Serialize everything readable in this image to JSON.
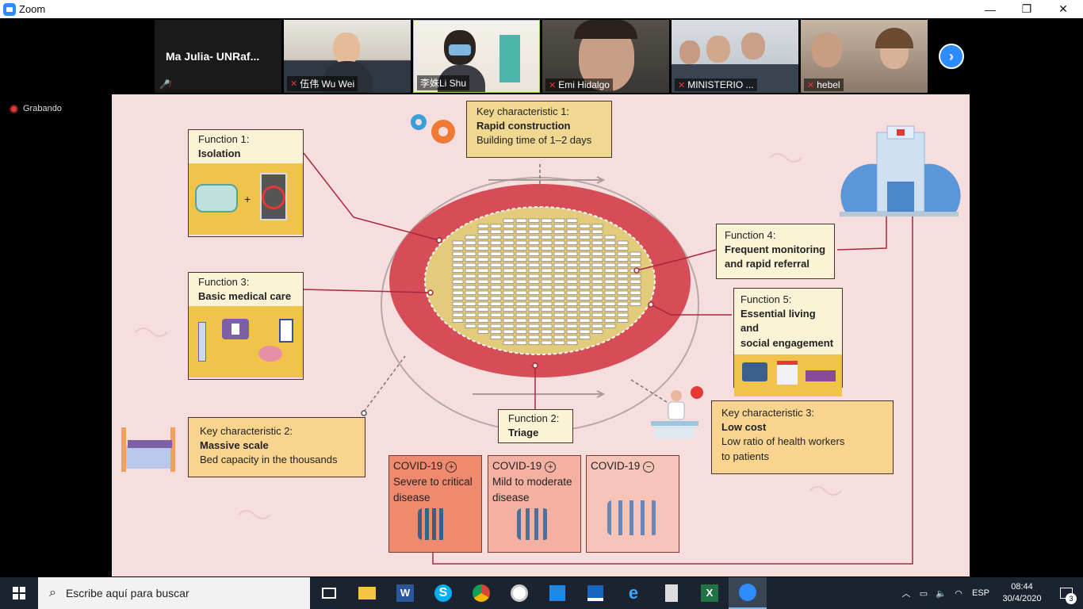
{
  "window": {
    "title": "Zoom",
    "minimize": "—",
    "maximize": "❐",
    "close": "✕"
  },
  "participants": [
    {
      "name": "Ma Julia- UNRaf...",
      "kind": "text"
    },
    {
      "name": "伍伟  Wu Wei",
      "kind": "video"
    },
    {
      "name": "李姝Li Shu",
      "kind": "video"
    },
    {
      "name": "Emi Hidalgo",
      "kind": "video"
    },
    {
      "name": "MINISTERIO ...",
      "kind": "video"
    },
    {
      "name": "hebel",
      "kind": "video"
    }
  ],
  "recording": {
    "label": "Grabando"
  },
  "slide": {
    "kc1": {
      "title": "Key characteristic 1:",
      "bold": "Rapid construction",
      "detail": "Building time of 1–2 days"
    },
    "kc2": {
      "title": "Key characteristic 2:",
      "bold": "Massive scale",
      "detail": "Bed capacity in the thousands"
    },
    "kc3": {
      "title": "Key characteristic 3:",
      "bold": "Low cost",
      "detail1": "Low ratio of health workers",
      "detail2": "to patients"
    },
    "f1": {
      "title": "Function 1:",
      "bold": "Isolation"
    },
    "f2": {
      "title": "Function 2:",
      "bold": "Triage"
    },
    "f3": {
      "title": "Function 3:",
      "bold": "Basic medical care"
    },
    "f4": {
      "title": "Function 4:",
      "bold1": "Frequent monitoring",
      "bold2": "and rapid referral"
    },
    "f5": {
      "title": "Function 5:",
      "bold1": "Essential living and",
      "bold2": "social engagement"
    },
    "covid": [
      {
        "label": "COVID-19",
        "sign": "+",
        "line1": "Severe to critical",
        "line2": " disease",
        "color": "#f08a6e"
      },
      {
        "label": "COVID-19",
        "sign": "+",
        "line1": "Mild to moderate",
        "line2": "disease",
        "color": "#f4b0a0"
      },
      {
        "label": "COVID-19",
        "sign": "−",
        "line1": "",
        "line2": "",
        "color": "#f6c4b8"
      }
    ],
    "colors": {
      "track": "#d64d58",
      "field": "#e2cc7c",
      "line": "#a8283c",
      "accent_yellow": "#f0c44a"
    }
  },
  "taskbar": {
    "search_placeholder": "Escribe aquí para buscar",
    "lang": "ESP",
    "time": "08:44",
    "date": "30/4/2020",
    "notifications": "3"
  }
}
